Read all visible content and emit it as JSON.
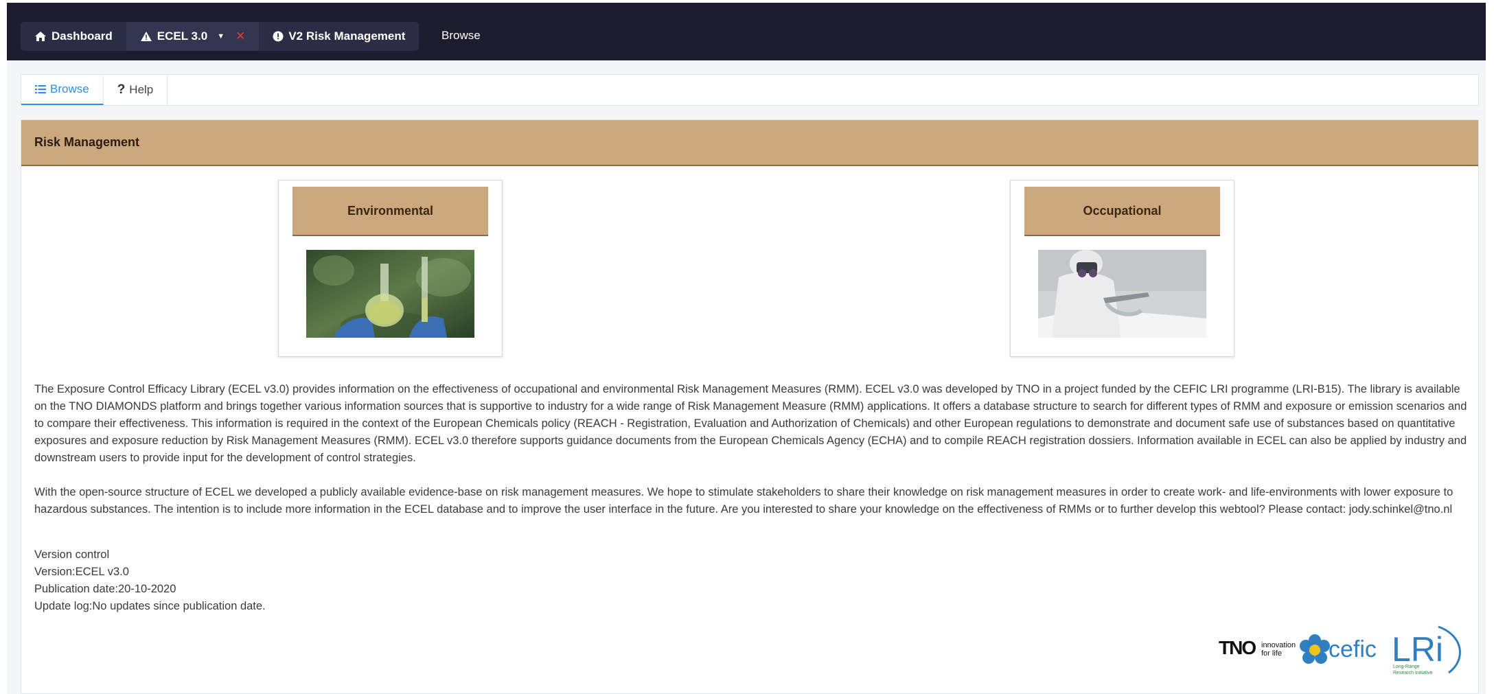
{
  "topbar": {
    "crumbs": [
      {
        "label": "Dashboard",
        "icon": "home-icon"
      },
      {
        "label": "ECEL 3.0",
        "icon": "warning-icon"
      },
      {
        "label": "V2 Risk Management",
        "icon": "info-circle-icon"
      }
    ],
    "current": "Browse"
  },
  "tabs": [
    {
      "label": "Browse",
      "icon": "list-icon",
      "active": true
    },
    {
      "label": "Help",
      "icon": "question-icon",
      "active": false
    }
  ],
  "panel": {
    "title": "Risk Management",
    "cards": [
      {
        "title": "Environmental",
        "image": "lab-flask-image"
      },
      {
        "title": "Occupational",
        "image": "worker-protective-gear-image"
      }
    ],
    "paragraph1": "The Exposure Control Efficacy Library (ECEL v3.0) provides information on the effectiveness of occupational and environmental Risk Management Measures (RMM). ECEL v3.0 was developed by TNO in a project funded by the CEFIC LRI programme (LRI-B15). The library is available on the TNO DIAMONDS platform and brings together various information sources that is supportive to industry for a wide range of Risk Management Measure (RMM) applications. It offers a database structure to search for different types of RMM and exposure or emission scenarios and to compare their effectiveness. This information is required in the context of the European Chemicals policy (REACH - Registration, Evaluation and Authorization of Chemicals) and other European regulations to demonstrate and document safe use of substances based on quantitative exposures and exposure reduction by Risk Management Measures (RMM). ECEL v3.0 therefore supports guidance documents from the European Chemicals Agency (ECHA) and to compile REACH registration dossiers. Information available in ECEL can also be applied by industry and downstream users to provide input for the development of control strategies.",
    "paragraph2": "With the open-source structure of ECEL we developed a publicly available evidence-base on risk management measures. We hope to stimulate stakeholders to share their knowledge on risk management measures in order to create work- and life-environments with lower exposure to hazardous substances. The intention is to include more information in the ECEL database and to improve the user interface in the future. Are you interested to share your knowledge on the effectiveness of RMMs or to further develop this webtool? Please contact: jody.schinkel@tno.nl",
    "version": {
      "heading": "Version control",
      "version": "Version:ECEL v3.0",
      "publication": "Publication date:20-10-2020",
      "update": "Update log:No updates since publication date."
    },
    "logos": {
      "tno": "TNO",
      "tno_tagline_1": "innovation",
      "tno_tagline_2": "for life",
      "cefic": "cefic",
      "lri": "LRi",
      "lri_sub_1": "Long-Range",
      "lri_sub_2": "Research Initiative"
    }
  },
  "colors": {
    "topbar": "#1c1c2e",
    "accent_tan": "#cca87f",
    "active_tab": "#2f8de4"
  }
}
